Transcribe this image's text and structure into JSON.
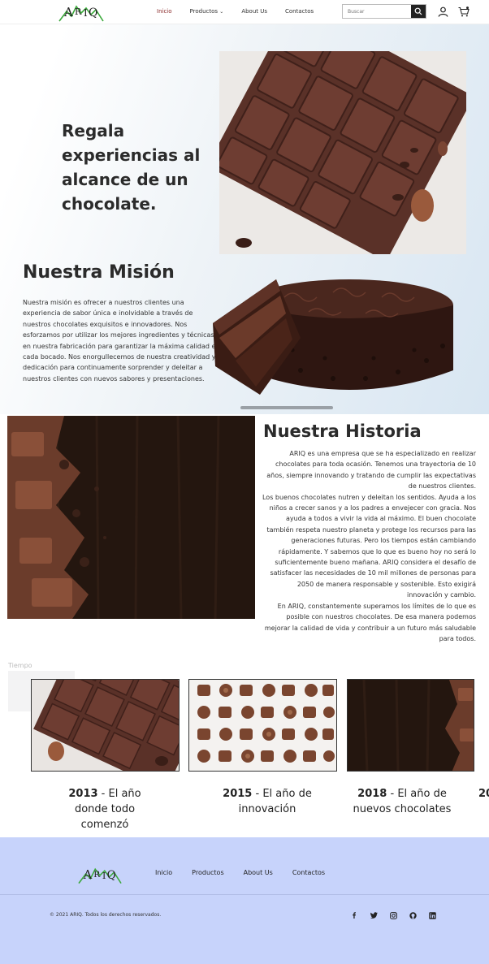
{
  "brand": {
    "logo_text": "ARIQ",
    "accent": "#3aa83a",
    "dark": "#222222"
  },
  "nav": {
    "links": [
      {
        "label": "Inicio",
        "active": true
      },
      {
        "label": "Productos",
        "dropdown": true
      },
      {
        "label": "About Us"
      },
      {
        "label": "Contactos"
      }
    ],
    "search_placeholder": "Buscar",
    "icons": [
      "search-icon",
      "user-icon",
      "cart-icon"
    ]
  },
  "hero": {
    "title": "Regala experiencias al alcance de un chocolate.",
    "image": "chocolate-bar-photo"
  },
  "mission": {
    "title": "Nuestra Misión",
    "text": "Nuestra misión es ofrecer a nuestros clientes una experiencia de sabor única e inolvidable a través de nuestros chocolates exquisitos e innovadores. Nos esforzamos por utilizar los mejores ingredientes y técnicas en nuestra fabricación para garantizar la máxima calidad en cada bocado. Nos enorgullecemos de nuestra creatividad y dedicación para continuamente sorprender y deleitar a nuestros clientes con nuevos sabores y presentaciones.",
    "image": "chocolate-cake-photo"
  },
  "history": {
    "title": "Nuestra Historia",
    "paragraphs": [
      "ARIQ es una empresa que se ha especializado en realizar chocolates para toda ocasión. Tenemos una trayectoria de 10 años, siempre innovando y tratando de cumplir las expectativas de nuestros clientes.",
      "Los buenos chocolates nutren y deleitan los sentidos. Ayuda a los niños a crecer sanos y a los padres a envejecer con gracia. Nos ayuda a todos a vivir la vida al máximo. El buen chocolate también respeta nuestro planeta y protege los recursos para las generaciones futuras.  Pero los tiempos están cambiando rápidamente. Y sabemos que lo que es bueno hoy no será lo suficientemente bueno mañana. ARIQ considera el desafío de satisfacer las necesidades de 10 mil millones de personas para 2050 de manera responsable y sostenible. Esto exigirá innovación y cambio.",
      "En ARIQ, constantemente superamos los límites de lo que es posible con nuestros chocolates. De esa manera podemos mejorar la calidad de vida y contribuir a un futuro más saludable para todos."
    ],
    "image": "dark-wood-chocolate-photo"
  },
  "timeline": {
    "label": "Tiempo",
    "items": [
      {
        "year": "2013",
        "text": " - El año donde todo comenzó"
      },
      {
        "year": "2015",
        "text": " - El año de innovación"
      },
      {
        "year": "2018",
        "text": " - El año de nuevos chocolates"
      },
      {
        "year": "20",
        "text": ""
      }
    ]
  },
  "footer": {
    "links": [
      "Inicio",
      "Productos",
      "About Us",
      "Contactos"
    ],
    "copyright": "© 2021 ARIQ. Todos los derechos reservados.",
    "social_icons": [
      "facebook-icon",
      "twitter-icon",
      "instagram-icon",
      "github-icon",
      "linkedin-icon"
    ],
    "background": "#c7d3fb"
  }
}
